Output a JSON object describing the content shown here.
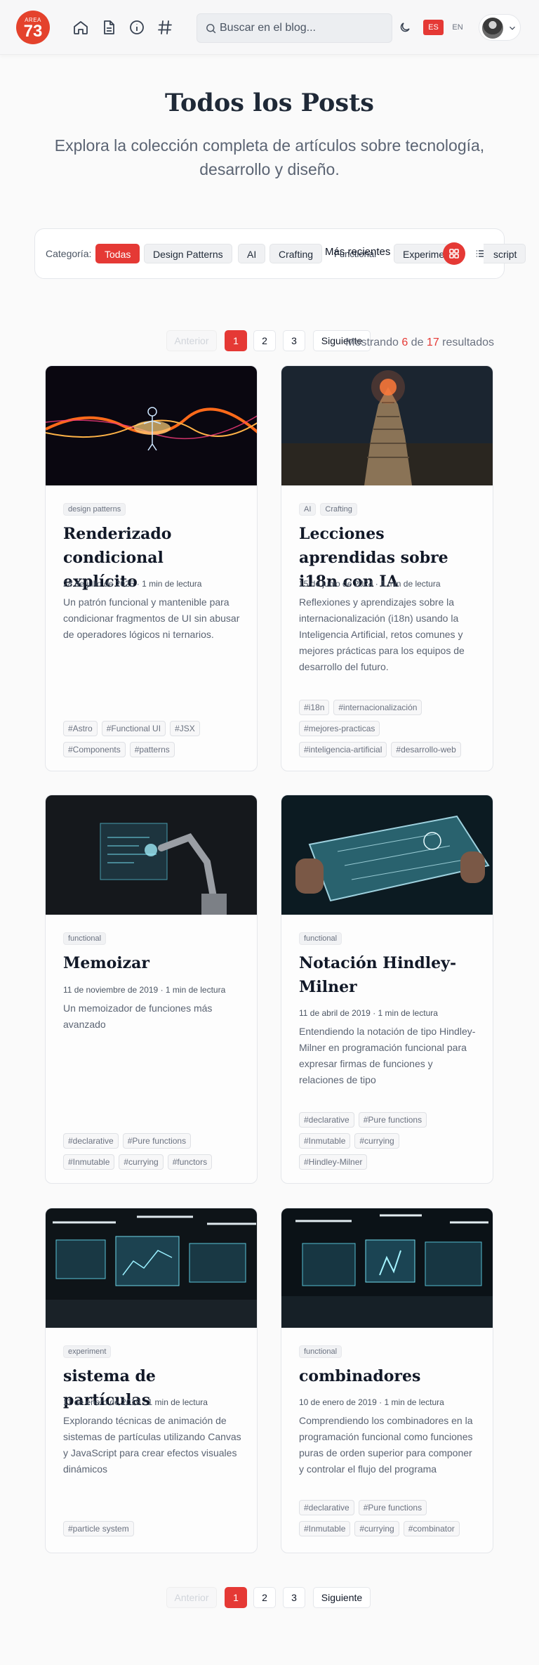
{
  "header": {
    "logo_top": "AREA",
    "logo_num": "73",
    "search_placeholder": "Buscar en el blog...",
    "lang_es": "ES",
    "lang_en": "EN",
    "nav_icons": [
      "home-icon",
      "document-icon",
      "info-icon",
      "hashtag-icon"
    ]
  },
  "hero": {
    "title": "Todos los Posts",
    "subtitle": "Explora la colección completa de artículos sobre tecnología, desarrollo y diseño."
  },
  "filter": {
    "label": "Categoría:",
    "chips": [
      "Todas",
      "Design Patterns",
      "AI",
      "Crafting",
      "Functional",
      "Experiment"
    ],
    "sort_value": "Más recientes",
    "overflow_chip": "script",
    "accent": "#e53935"
  },
  "pagination": {
    "prev": "Anterior",
    "pages": [
      "1",
      "2",
      "3"
    ],
    "next": "Siguiente",
    "current": "1"
  },
  "results": {
    "prefix": "Mostrando",
    "shown": "6",
    "of": "de",
    "total": "17",
    "suffix": "resultados"
  },
  "posts": [
    {
      "tags": [
        "design patterns"
      ],
      "title": "Renderizado condicional explícito",
      "date": "28 de julio de 2025",
      "read": "· 1 min de lectura",
      "desc": "Un patrón funcional y mantenible para condicionar fragmentos de UI sin abusar de operadores lógicos ni ternarios.",
      "hashtags": [
        "#Astro",
        "#Functional UI",
        "#JSX",
        "#Components",
        "#patterns"
      ]
    },
    {
      "tags": [
        "AI",
        "Crafting"
      ],
      "title": "Lecciones aprendidas sobre i18n con IA",
      "date": "15 de junio de 2024",
      "read": "· 1 min de lectura",
      "desc": "Reflexiones y aprendizajes sobre la internacionalización (i18n) usando la Inteligencia Artificial, retos comunes y mejores prácticas para los equipos de desarrollo del futuro.",
      "hashtags": [
        "#i18n",
        "#internacionalización",
        "#mejores-practicas",
        "#inteligencia-artificial",
        "#desarrollo-web"
      ]
    },
    {
      "tags": [
        "functional"
      ],
      "title": "Memoizar",
      "date": "11 de noviembre de 2019",
      "read": "· 1 min de lectura",
      "desc": "Un memoizador de funciones más avanzado",
      "hashtags": [
        "#declarative",
        "#Pure functions",
        "#Inmutable",
        "#currying",
        "#functors"
      ]
    },
    {
      "tags": [
        "functional"
      ],
      "title": "Notación Hindley-Milner",
      "date": "11 de abril de 2019",
      "read": "· 1 min de lectura",
      "desc": "Entendiendo la notación de tipo Hindley-Milner en programación funcional para expresar firmas de funciones y relaciones de tipo",
      "hashtags": [
        "#declarative",
        "#Pure functions",
        "#Inmutable",
        "#currying",
        "#Hindley-Milner"
      ]
    },
    {
      "tags": [
        "experiment"
      ],
      "title": "sistema de partículas",
      "date": "11 de enero de 2019",
      "read": "· 1 min de lectura",
      "desc": "Explorando técnicas de animación de sistemas de partículas utilizando Canvas y JavaScript para crear efectos visuales dinámicos",
      "hashtags": [
        "#particle system"
      ]
    },
    {
      "tags": [
        "functional"
      ],
      "title": "combinadores",
      "date": "10 de enero de 2019",
      "read": "· 1 min de lectura",
      "desc": "Comprendiendo los combinadores en la programación funcional como funciones puras de orden superior para componer y controlar el flujo del programa",
      "hashtags": [
        "#declarative",
        "#Pure functions",
        "#Inmutable",
        "#currying",
        "#combinator"
      ]
    }
  ]
}
